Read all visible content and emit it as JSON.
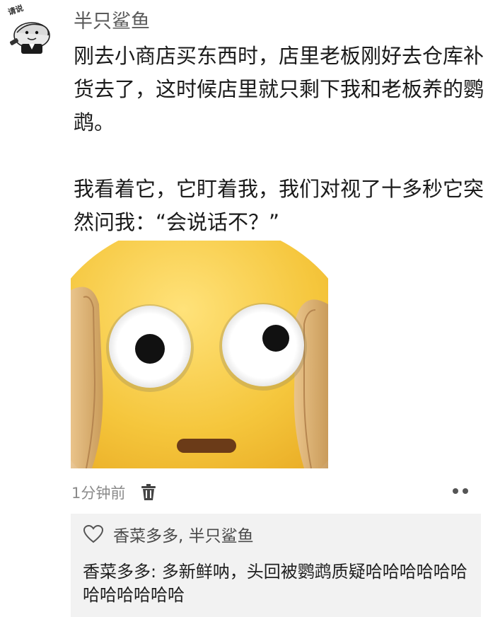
{
  "post": {
    "avatar_caption": "请说",
    "author": "半只鲨鱼",
    "paragraph1": "刚去小商店买东西时，店里老板刚好去仓库补货去了，这时候店里就只剩下我和老板养的鹦鹉。",
    "paragraph2": "我看着它，它盯着我，我们对视了十多秒它突然问我：“会说话不？”",
    "image_icon": "surprised-face-emoji",
    "timestamp": "1分钟前"
  },
  "likes": {
    "icon": "heart-icon",
    "names": "香菜多多, 半只鲨鱼"
  },
  "comment": {
    "author": "香菜多多",
    "separator": ": ",
    "text": "多新鲜呐，头回被鹦鹉质疑哈哈哈哈哈哈哈哈哈哈哈哈"
  },
  "colors": {
    "comment_bg": "#f2f2f2",
    "emoji_face": "#f3c43a",
    "author_text": "#5a5a5a"
  }
}
